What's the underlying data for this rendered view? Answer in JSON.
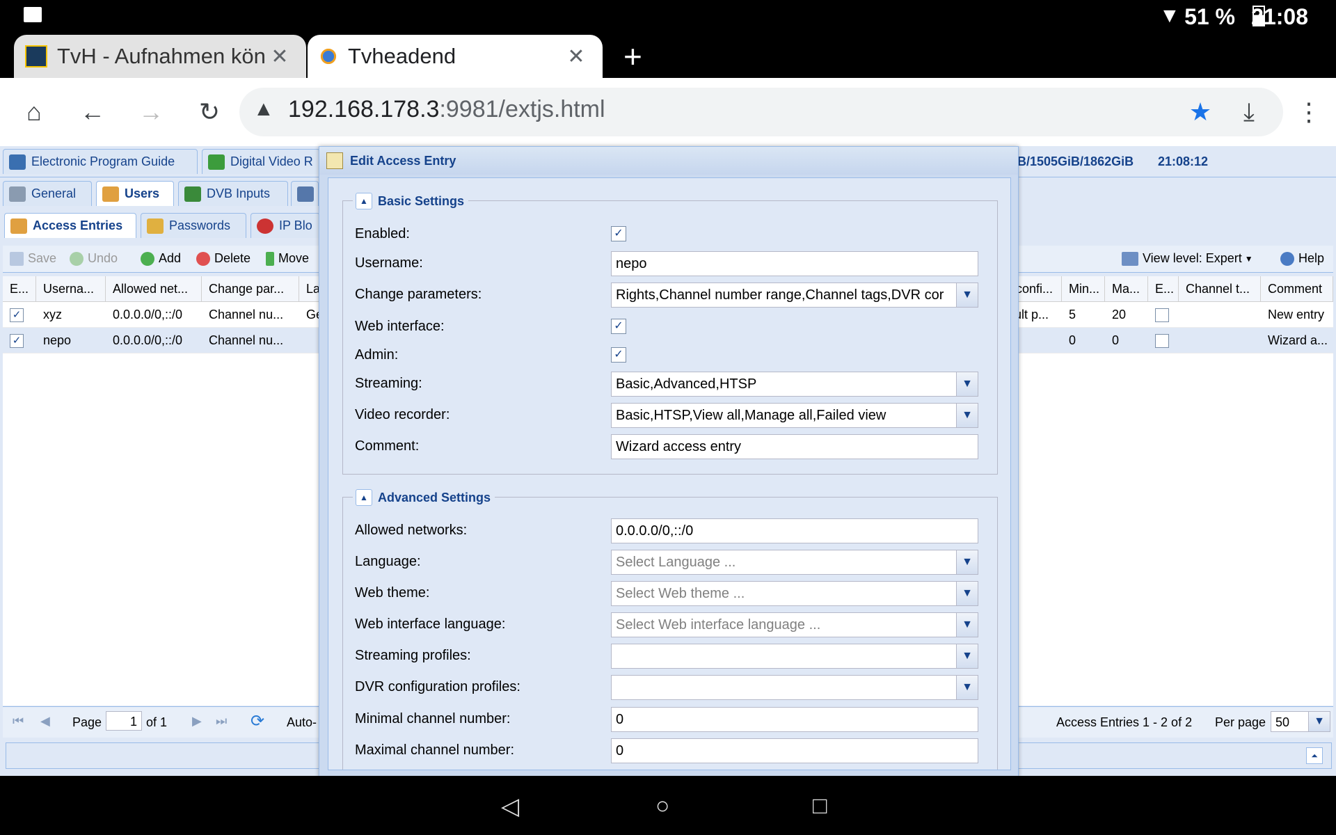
{
  "status_bar": {
    "battery": "51 %",
    "time": "21:08"
  },
  "browser": {
    "tabs": [
      {
        "label": "TvH - Aufnahmen könr",
        "active": false
      },
      {
        "label": "Tvheadend",
        "active": true
      }
    ],
    "new_tab": "+",
    "close_glyph": "✕",
    "url_host": "192.168.178.3",
    "url_rest": ":9981/extjs.html"
  },
  "app": {
    "top_tabs": [
      "Electronic Program Guide",
      "Digital Video R"
    ],
    "top_right_info": "B/1505GiB/1862GiB",
    "clock": "21:08:12",
    "config_tabs": [
      "General",
      "Users",
      "DVB Inputs"
    ],
    "user_tabs": [
      "Access Entries",
      "Passwords",
      "IP Blo"
    ],
    "toolbar": {
      "save": "Save",
      "undo": "Undo",
      "add": "Add",
      "delete": "Delete",
      "move": "Move",
      "view_level": "View level: Expert",
      "help": "Help"
    },
    "columns_left": [
      "E...",
      "Userna...",
      "Allowed net...",
      "Change par...",
      "La"
    ],
    "columns_right": [
      "confi...",
      "Min...",
      "Ma...",
      "E...",
      "Channel t...",
      "Comment"
    ],
    "rows": [
      {
        "user": "xyz",
        "net": "0.0.0.0/0,::/0",
        "change": "Channel nu...",
        "lang": "Ge",
        "conf": "ult p...",
        "min": "5",
        "max": "20",
        "comment": "New entry"
      },
      {
        "user": "nepo",
        "net": "0.0.0.0/0,::/0",
        "change": "Channel nu...",
        "lang": "",
        "conf": "",
        "min": "0",
        "max": "0",
        "comment": "Wizard a..."
      }
    ],
    "paging": {
      "page_label": "Page",
      "page_value": "1",
      "of": "of 1",
      "auto": "Auto-",
      "summary": "Access Entries 1 - 2 of 2",
      "per_page_label": "Per page",
      "per_page_value": "50"
    }
  },
  "dialog": {
    "title": "Edit Access Entry",
    "basic": {
      "legend": "Basic Settings",
      "enabled_label": "Enabled:",
      "username_label": "Username:",
      "username_value": "nepo",
      "change_label": "Change parameters:",
      "change_value": "Rights,Channel number range,Channel tags,DVR cor",
      "web_label": "Web interface:",
      "admin_label": "Admin:",
      "streaming_label": "Streaming:",
      "streaming_value": "Basic,Advanced,HTSP",
      "recorder_label": "Video recorder:",
      "recorder_value": "Basic,HTSP,View all,Manage all,Failed view",
      "comment_label": "Comment:",
      "comment_value": "Wizard access entry"
    },
    "advanced": {
      "legend": "Advanced Settings",
      "networks_label": "Allowed networks:",
      "networks_value": "0.0.0.0/0,::/0",
      "language_label": "Language:",
      "language_placeholder": "Select Language ...",
      "theme_label": "Web theme:",
      "theme_placeholder": "Select Web theme ...",
      "ui_lang_label": "Web interface language:",
      "ui_lang_placeholder": "Select Web interface language ...",
      "stream_profiles_label": "Streaming profiles:",
      "dvr_profiles_label": "DVR configuration profiles:",
      "min_chan_label": "Minimal channel number:",
      "min_chan_value": "0",
      "max_chan_label": "Maximal channel number:",
      "max_chan_value": "0"
    }
  }
}
